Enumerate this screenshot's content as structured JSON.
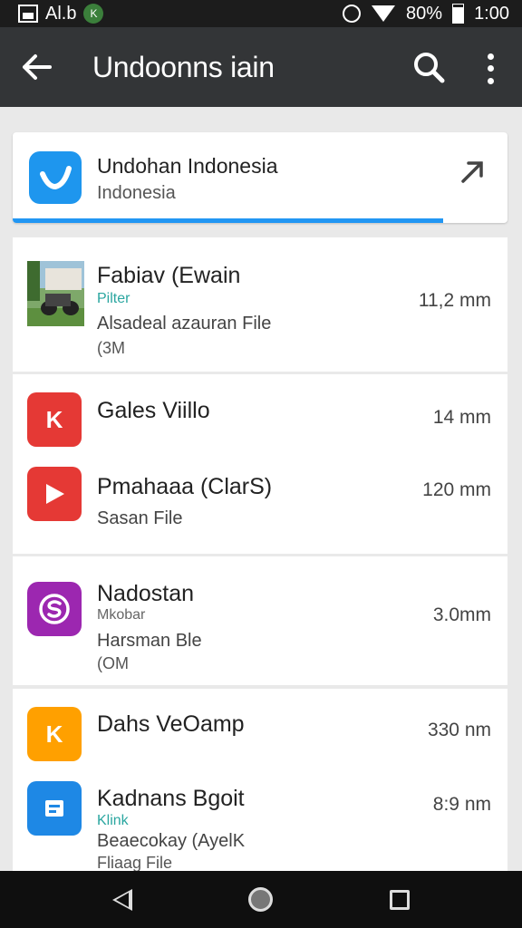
{
  "status_bar": {
    "carrier": "Al.b",
    "notification_icon": "K",
    "battery": "80%",
    "time": "1:00",
    "icons": [
      "image-icon",
      "notification-icon",
      "alarm-icon",
      "wifi-icon",
      "battery-icon"
    ]
  },
  "toolbar": {
    "title": "Undoonns iain",
    "back_icon": "arrow-back-icon",
    "search_icon": "search-icon",
    "more_icon": "more-vert-icon"
  },
  "top_card": {
    "title": "Undohan Indonesia",
    "subtitle": "Indonesia",
    "progress": 0.87,
    "accent": "#2196f3",
    "icon": "check-icon",
    "arrow_icon": "arrow-icon"
  },
  "files": [
    {
      "title": "Fabiav (Ewain",
      "label": "Pilter",
      "desc": "Alsadeal azauran File",
      "extra": "(3M",
      "size": "11,2 mm",
      "icon": "photo-thumbnail"
    },
    {
      "title": "Gales Viillo",
      "size": "14 mm",
      "icon": "k-logo-icon",
      "color": "#e53935"
    },
    {
      "title": "Pmahaaa (ClarS)",
      "desc": "Sasan File",
      "size": "120 mm",
      "icon": "play-icon",
      "color": "#e53935"
    },
    {
      "title": "Nadostan",
      "label": "Mkobar",
      "desc": "Harsman Ble",
      "extra": "(OM",
      "size": "3.0mm",
      "icon": "s-logo-icon",
      "color": "#9c27b0"
    },
    {
      "title": "Dahs VeOamp",
      "size": "330 nm",
      "icon": "k-logo-icon",
      "color": "#ffa000"
    },
    {
      "title": "Kadnans Bgoit",
      "label": "Klink",
      "desc": "Beaecokay (AyelK",
      "extra": "Fliaag File",
      "size": "8:9 nm",
      "icon": "document-icon",
      "color": "#1e88e5"
    }
  ],
  "nav_bar": {
    "back_icon": "nav-back-icon",
    "home_icon": "nav-home-icon",
    "recents_icon": "nav-recents-icon"
  }
}
